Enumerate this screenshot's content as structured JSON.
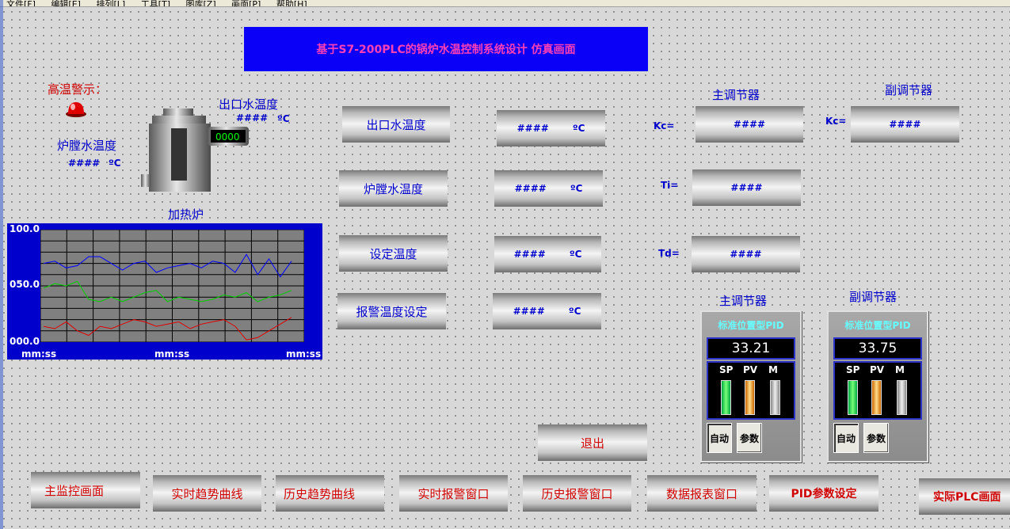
{
  "menu": [
    "文件[F]",
    "编辑[E]",
    "排列[L]",
    "工具[T]",
    "图库[Z]",
    "画面[P]",
    "帮助[H]"
  ],
  "title": "基于S7-200PLC的锅炉水温控制系统设计  仿真画面",
  "alarm_label": "高温警示：",
  "furnace": {
    "outlet_label": "出口水温度",
    "outlet_value": "####",
    "outlet_unit": "ºC",
    "chamber_label": "炉膛水温度",
    "chamber_value": "####",
    "chamber_unit": "ºC",
    "meter": "0000",
    "name": "加热炉"
  },
  "trend": {
    "y_ticks": [
      "100.0",
      "050.0",
      "000.0"
    ],
    "x_ticks": [
      "mm:ss",
      "mm:ss",
      "mm:ss"
    ],
    "colors": [
      "#0000ff",
      "#00d000",
      "#e00000"
    ],
    "series": [
      [
        70,
        72,
        66,
        68,
        76,
        76,
        70,
        64,
        70,
        72,
        62,
        66,
        68,
        70,
        66,
        72,
        70,
        62,
        78,
        60,
        74,
        58,
        72
      ],
      [
        48,
        52,
        50,
        54,
        38,
        36,
        40,
        36,
        40,
        44,
        46,
        36,
        40,
        38,
        36,
        38,
        42,
        40,
        44,
        36,
        40,
        42,
        46
      ],
      [
        14,
        12,
        18,
        10,
        6,
        14,
        12,
        16,
        20,
        18,
        14,
        16,
        18,
        12,
        16,
        18,
        20,
        14,
        2,
        4,
        10,
        16,
        22
      ]
    ]
  },
  "rows": [
    {
      "label": "出口水温度",
      "value": "####",
      "unit": "ºC"
    },
    {
      "label": "炉膛水温度",
      "value": "####",
      "unit": "ºC"
    },
    {
      "label": "设定温度",
      "value": "####",
      "unit": "ºC"
    },
    {
      "label": "报警温度设定",
      "value": "####",
      "unit": "ºC"
    }
  ],
  "main_regulator": {
    "label": "主调节器",
    "kc_label": "Kc=",
    "kc": "####",
    "ti_label": "Ti=",
    "ti": "####",
    "td_label": "Td=",
    "td": "####"
  },
  "sub_regulator": {
    "label": "副调节器",
    "kc_label": "Kc=",
    "kc": "####"
  },
  "pid_main": {
    "label": "主调节器",
    "title": "标准位置型PID",
    "value": "33.21",
    "sp": "SP",
    "pv": "PV",
    "m": "M",
    "auto": "自动",
    "param": "参数"
  },
  "pid_sub": {
    "label": "副调节器",
    "title": "标准位置型PID",
    "value": "33.75",
    "sp": "SP",
    "pv": "PV",
    "m": "M",
    "auto": "自动",
    "param": "参数"
  },
  "exit_label": "退出",
  "nav": [
    "主监控画面",
    "实时趋势曲线",
    "历史趋势曲线",
    "实时报警窗口",
    "历史报警窗口",
    "数据报表窗口",
    "PID参数设定",
    "实际PLC画面"
  ]
}
